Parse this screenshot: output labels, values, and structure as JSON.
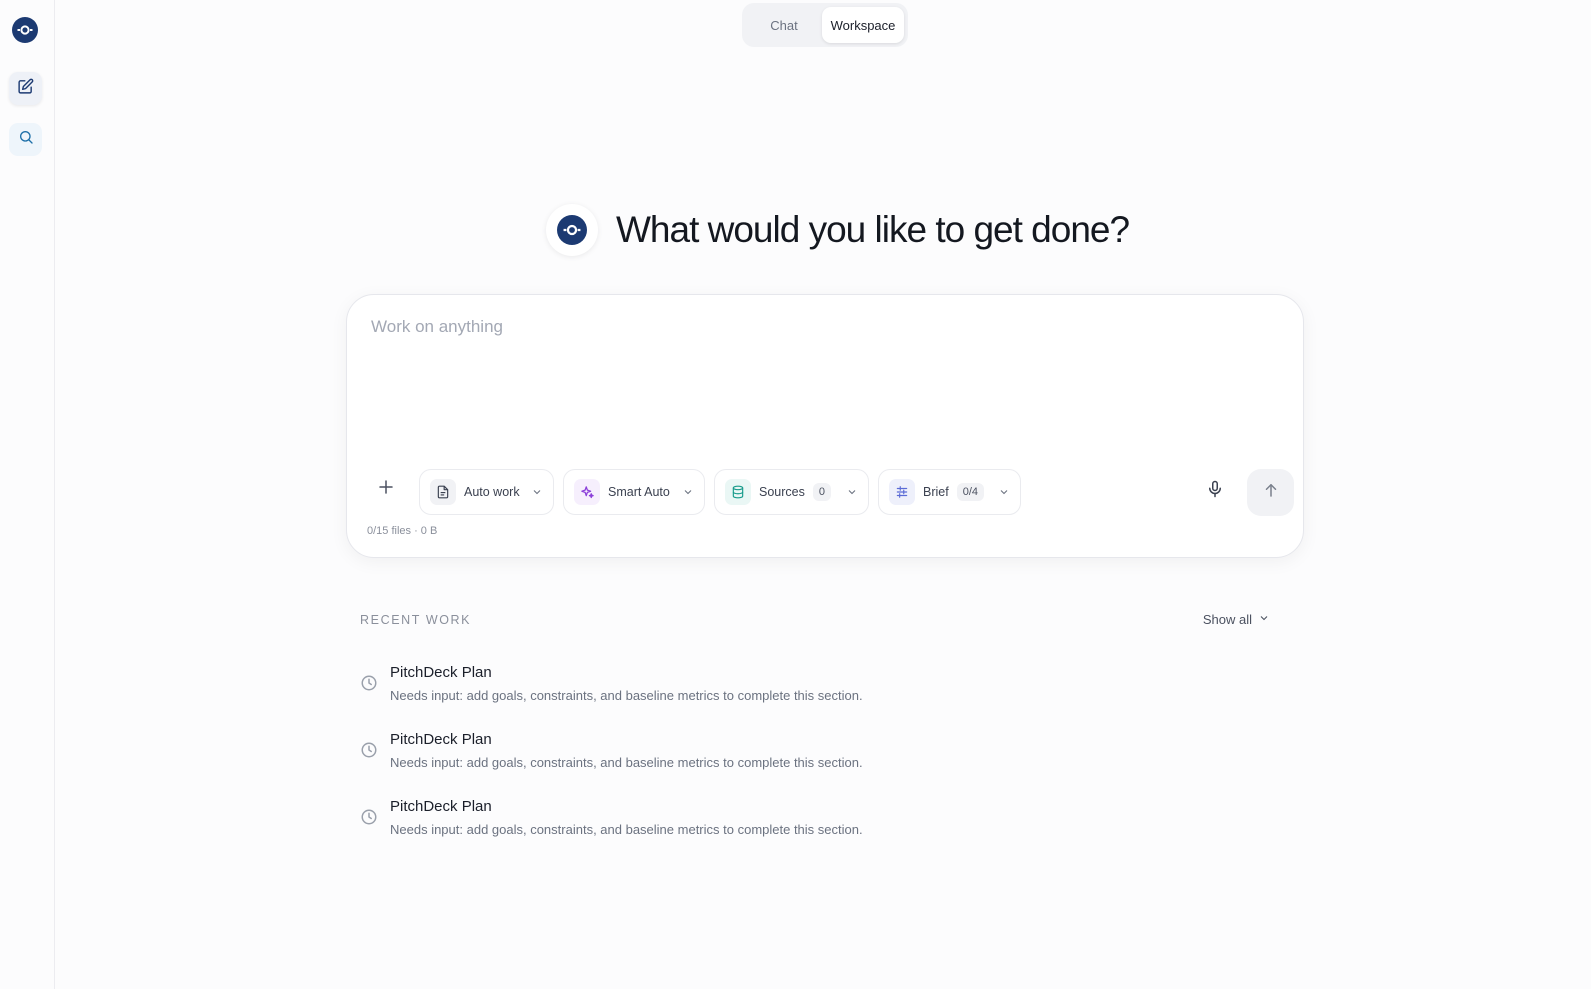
{
  "sidebar": {
    "logo_icon": "orbit-logo-icon",
    "items": [
      {
        "name": "new-work",
        "icon": "edit-square-icon"
      },
      {
        "name": "search",
        "icon": "search-icon"
      }
    ]
  },
  "mode_toggle": {
    "tabs": [
      {
        "label": "Chat",
        "selected": false
      },
      {
        "label": "Workspace",
        "selected": true
      }
    ]
  },
  "hero": {
    "title": "What would you like to get done?"
  },
  "composer": {
    "placeholder": "Work on anything",
    "value": "",
    "chips": {
      "auto_work": {
        "label": "Auto work",
        "icon": "document-icon"
      },
      "smart_auto": {
        "label": "Smart Auto",
        "icon": "sparkles-icon"
      },
      "sources": {
        "label": "Sources",
        "count": "0",
        "icon": "database-icon"
      },
      "brief": {
        "label": "Brief",
        "count": "0/4",
        "icon": "sliders-icon"
      }
    },
    "file_meta": "0/15 files · 0 B"
  },
  "recent": {
    "label": "RECENT WORK",
    "show_all": "Show all",
    "items": [
      {
        "title": "PitchDeck Plan",
        "desc": "Needs input: add goals, constraints, and baseline metrics to complete this section."
      },
      {
        "title": "PitchDeck Plan",
        "desc": "Needs input: add goals, constraints, and baseline metrics to complete this section."
      },
      {
        "title": "PitchDeck Plan",
        "desc": "Needs input: add goals, constraints, and baseline metrics to complete this section."
      }
    ]
  },
  "colors": {
    "brand": "#1c3a72",
    "smart_accent": "#8b3fd9",
    "sources_accent": "#1a9c8c",
    "brief_accent": "#5b6bd6"
  }
}
